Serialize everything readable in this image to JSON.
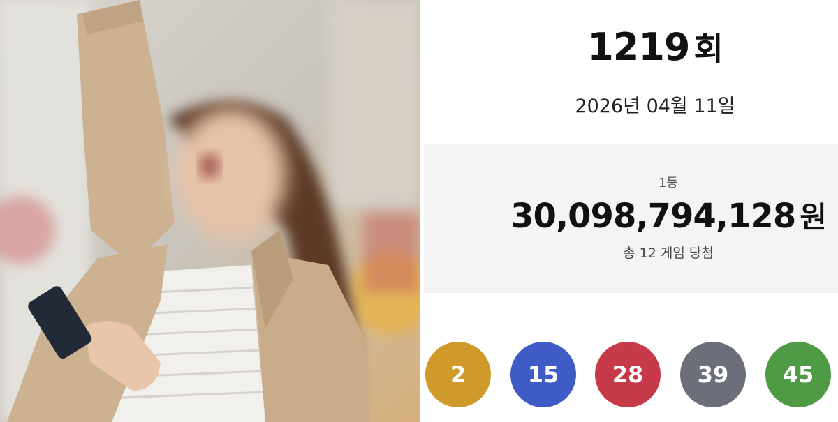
{
  "lotto": {
    "round_number": "1219",
    "round_unit": "회",
    "draw_date": "2026년 04월 11일",
    "prize": {
      "rank_label": "1등",
      "amount": "30,098,794,128",
      "currency": "원",
      "winners_text": "총 12 게임 당첨"
    },
    "numbers": [
      {
        "value": "2",
        "color": "#d09a2b"
      },
      {
        "value": "15",
        "color": "#3f5bc6"
      },
      {
        "value": "28",
        "color": "#c73a4a"
      },
      {
        "value": "39",
        "color": "#6c6f7a"
      },
      {
        "value": "45",
        "color": "#4e9a45"
      }
    ]
  },
  "photo": {
    "subject": "celebrating-woman-with-phone"
  }
}
